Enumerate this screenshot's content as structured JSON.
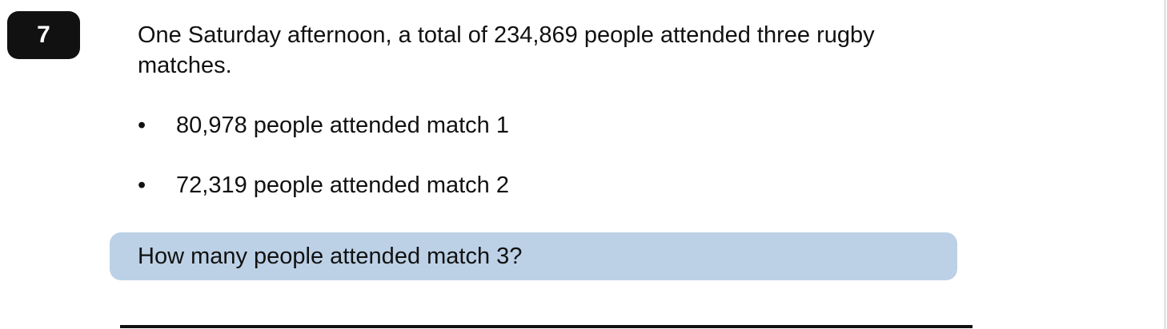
{
  "question": {
    "number": "7",
    "intro": "One Saturday afternoon, a total of 234,869 people attended three rugby matches.",
    "bullets": [
      {
        "marker": "•",
        "text": "80,978 people attended match 1"
      },
      {
        "marker": "•",
        "text": "72,319 people attended match 2"
      }
    ],
    "prompt": "How many people attended match 3?"
  }
}
